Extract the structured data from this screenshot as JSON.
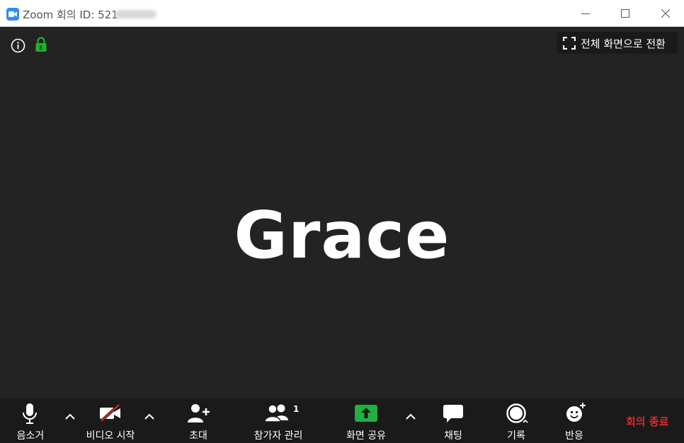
{
  "window": {
    "title": "Zoom 회의 ID: 521-"
  },
  "video": {
    "fullscreen_label": "전체 화면으로 전환",
    "participant_name": "Grace"
  },
  "toolbar": {
    "mute_label": "음소거",
    "video_label": "비디오 시작",
    "invite_label": "초대",
    "participants_label": "참가자 관리",
    "participants_count": "1",
    "share_label": "화면 공유",
    "chat_label": "채팅",
    "record_label": "기록",
    "reactions_label": "반응",
    "end_label": "회의 종료"
  },
  "colors": {
    "zoom_blue": "#2d8cff",
    "share_green": "#1fb141",
    "end_red": "#e02828",
    "lock_green": "#20b12c"
  },
  "icons": [
    "zoom-app-icon",
    "minimize-icon",
    "maximize-icon",
    "close-icon",
    "info-icon",
    "lock-icon",
    "fullscreen-icon",
    "microphone-icon",
    "video-off-icon",
    "add-person-icon",
    "participants-icon",
    "share-screen-icon",
    "chat-icon",
    "record-icon",
    "reaction-icon",
    "chevron-up-icon"
  ]
}
